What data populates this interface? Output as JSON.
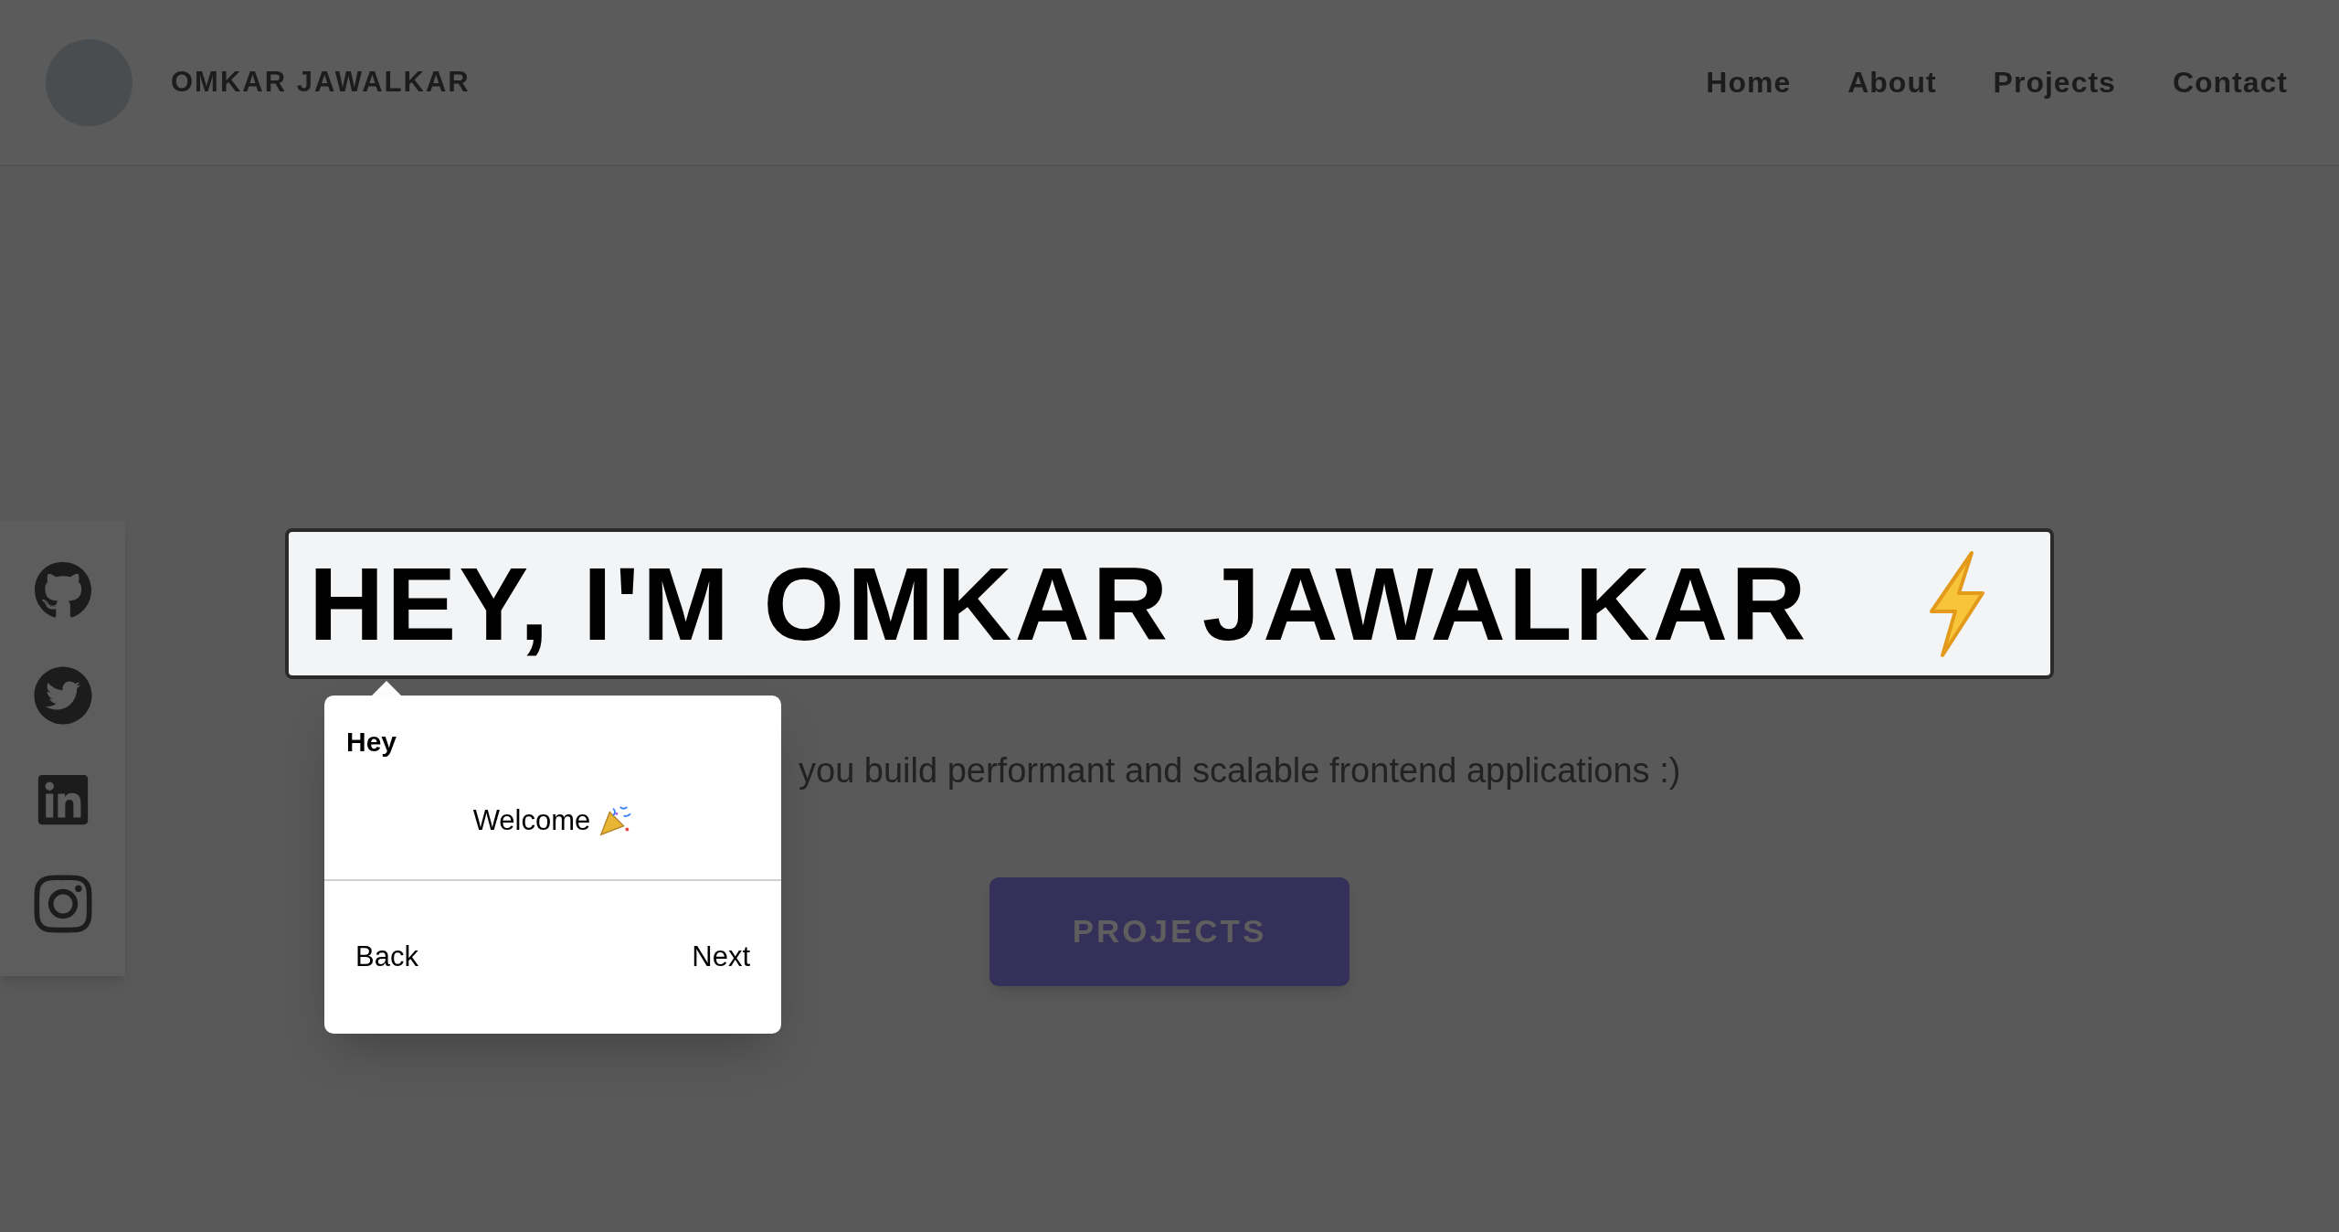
{
  "header": {
    "name": "OMKAR JAWALKAR",
    "nav": [
      "Home",
      "About",
      "Projects",
      "Contact"
    ]
  },
  "hero": {
    "title": "HEY, I'M OMKAR JAWALKAR",
    "subtitle": "you build performant and scalable frontend applications :)",
    "button": "PROJECTS"
  },
  "tour_popup": {
    "title": "Hey",
    "body": "Welcome",
    "back": "Back",
    "next": "Next"
  }
}
